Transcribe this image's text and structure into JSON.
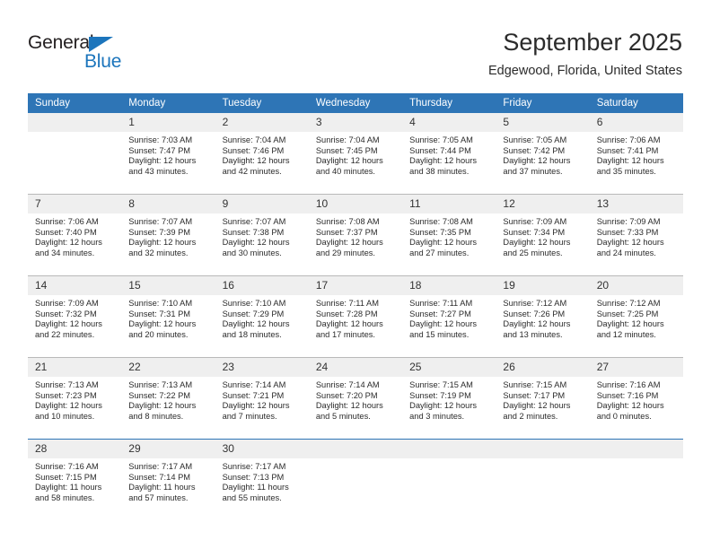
{
  "brand": {
    "name_dark": "General",
    "name_blue": "Blue",
    "accent_color": "#1c75bc"
  },
  "header": {
    "title": "September 2025",
    "subtitle": "Edgewood, Florida, United States"
  },
  "theme": {
    "header_row_bg": "#2e75b6",
    "header_row_text": "#ffffff",
    "daynumber_bg": "#efefef",
    "cell_border": "#b9b9b9",
    "text_color": "#2b2b2b"
  },
  "calendar": {
    "weekday_headers": [
      "Sunday",
      "Monday",
      "Tuesday",
      "Wednesday",
      "Thursday",
      "Friday",
      "Saturday"
    ],
    "weeks": [
      [
        {
          "day": ""
        },
        {
          "day": "1",
          "sunrise": "Sunrise: 7:03 AM",
          "sunset": "Sunset: 7:47 PM",
          "daylight_line1": "Daylight: 12 hours",
          "daylight_line2": "and 43 minutes."
        },
        {
          "day": "2",
          "sunrise": "Sunrise: 7:04 AM",
          "sunset": "Sunset: 7:46 PM",
          "daylight_line1": "Daylight: 12 hours",
          "daylight_line2": "and 42 minutes."
        },
        {
          "day": "3",
          "sunrise": "Sunrise: 7:04 AM",
          "sunset": "Sunset: 7:45 PM",
          "daylight_line1": "Daylight: 12 hours",
          "daylight_line2": "and 40 minutes."
        },
        {
          "day": "4",
          "sunrise": "Sunrise: 7:05 AM",
          "sunset": "Sunset: 7:44 PM",
          "daylight_line1": "Daylight: 12 hours",
          "daylight_line2": "and 38 minutes."
        },
        {
          "day": "5",
          "sunrise": "Sunrise: 7:05 AM",
          "sunset": "Sunset: 7:42 PM",
          "daylight_line1": "Daylight: 12 hours",
          "daylight_line2": "and 37 minutes."
        },
        {
          "day": "6",
          "sunrise": "Sunrise: 7:06 AM",
          "sunset": "Sunset: 7:41 PM",
          "daylight_line1": "Daylight: 12 hours",
          "daylight_line2": "and 35 minutes."
        }
      ],
      [
        {
          "day": "7",
          "sunrise": "Sunrise: 7:06 AM",
          "sunset": "Sunset: 7:40 PM",
          "daylight_line1": "Daylight: 12 hours",
          "daylight_line2": "and 34 minutes."
        },
        {
          "day": "8",
          "sunrise": "Sunrise: 7:07 AM",
          "sunset": "Sunset: 7:39 PM",
          "daylight_line1": "Daylight: 12 hours",
          "daylight_line2": "and 32 minutes."
        },
        {
          "day": "9",
          "sunrise": "Sunrise: 7:07 AM",
          "sunset": "Sunset: 7:38 PM",
          "daylight_line1": "Daylight: 12 hours",
          "daylight_line2": "and 30 minutes."
        },
        {
          "day": "10",
          "sunrise": "Sunrise: 7:08 AM",
          "sunset": "Sunset: 7:37 PM",
          "daylight_line1": "Daylight: 12 hours",
          "daylight_line2": "and 29 minutes."
        },
        {
          "day": "11",
          "sunrise": "Sunrise: 7:08 AM",
          "sunset": "Sunset: 7:35 PM",
          "daylight_line1": "Daylight: 12 hours",
          "daylight_line2": "and 27 minutes."
        },
        {
          "day": "12",
          "sunrise": "Sunrise: 7:09 AM",
          "sunset": "Sunset: 7:34 PM",
          "daylight_line1": "Daylight: 12 hours",
          "daylight_line2": "and 25 minutes."
        },
        {
          "day": "13",
          "sunrise": "Sunrise: 7:09 AM",
          "sunset": "Sunset: 7:33 PM",
          "daylight_line1": "Daylight: 12 hours",
          "daylight_line2": "and 24 minutes."
        }
      ],
      [
        {
          "day": "14",
          "sunrise": "Sunrise: 7:09 AM",
          "sunset": "Sunset: 7:32 PM",
          "daylight_line1": "Daylight: 12 hours",
          "daylight_line2": "and 22 minutes."
        },
        {
          "day": "15",
          "sunrise": "Sunrise: 7:10 AM",
          "sunset": "Sunset: 7:31 PM",
          "daylight_line1": "Daylight: 12 hours",
          "daylight_line2": "and 20 minutes."
        },
        {
          "day": "16",
          "sunrise": "Sunrise: 7:10 AM",
          "sunset": "Sunset: 7:29 PM",
          "daylight_line1": "Daylight: 12 hours",
          "daylight_line2": "and 18 minutes."
        },
        {
          "day": "17",
          "sunrise": "Sunrise: 7:11 AM",
          "sunset": "Sunset: 7:28 PM",
          "daylight_line1": "Daylight: 12 hours",
          "daylight_line2": "and 17 minutes."
        },
        {
          "day": "18",
          "sunrise": "Sunrise: 7:11 AM",
          "sunset": "Sunset: 7:27 PM",
          "daylight_line1": "Daylight: 12 hours",
          "daylight_line2": "and 15 minutes."
        },
        {
          "day": "19",
          "sunrise": "Sunrise: 7:12 AM",
          "sunset": "Sunset: 7:26 PM",
          "daylight_line1": "Daylight: 12 hours",
          "daylight_line2": "and 13 minutes."
        },
        {
          "day": "20",
          "sunrise": "Sunrise: 7:12 AM",
          "sunset": "Sunset: 7:25 PM",
          "daylight_line1": "Daylight: 12 hours",
          "daylight_line2": "and 12 minutes."
        }
      ],
      [
        {
          "day": "21",
          "sunrise": "Sunrise: 7:13 AM",
          "sunset": "Sunset: 7:23 PM",
          "daylight_line1": "Daylight: 12 hours",
          "daylight_line2": "and 10 minutes."
        },
        {
          "day": "22",
          "sunrise": "Sunrise: 7:13 AM",
          "sunset": "Sunset: 7:22 PM",
          "daylight_line1": "Daylight: 12 hours",
          "daylight_line2": "and 8 minutes."
        },
        {
          "day": "23",
          "sunrise": "Sunrise: 7:14 AM",
          "sunset": "Sunset: 7:21 PM",
          "daylight_line1": "Daylight: 12 hours",
          "daylight_line2": "and 7 minutes."
        },
        {
          "day": "24",
          "sunrise": "Sunrise: 7:14 AM",
          "sunset": "Sunset: 7:20 PM",
          "daylight_line1": "Daylight: 12 hours",
          "daylight_line2": "and 5 minutes."
        },
        {
          "day": "25",
          "sunrise": "Sunrise: 7:15 AM",
          "sunset": "Sunset: 7:19 PM",
          "daylight_line1": "Daylight: 12 hours",
          "daylight_line2": "and 3 minutes."
        },
        {
          "day": "26",
          "sunrise": "Sunrise: 7:15 AM",
          "sunset": "Sunset: 7:17 PM",
          "daylight_line1": "Daylight: 12 hours",
          "daylight_line2": "and 2 minutes."
        },
        {
          "day": "27",
          "sunrise": "Sunrise: 7:16 AM",
          "sunset": "Sunset: 7:16 PM",
          "daylight_line1": "Daylight: 12 hours",
          "daylight_line2": "and 0 minutes."
        }
      ],
      [
        {
          "day": "28",
          "sunrise": "Sunrise: 7:16 AM",
          "sunset": "Sunset: 7:15 PM",
          "daylight_line1": "Daylight: 11 hours",
          "daylight_line2": "and 58 minutes."
        },
        {
          "day": "29",
          "sunrise": "Sunrise: 7:17 AM",
          "sunset": "Sunset: 7:14 PM",
          "daylight_line1": "Daylight: 11 hours",
          "daylight_line2": "and 57 minutes."
        },
        {
          "day": "30",
          "sunrise": "Sunrise: 7:17 AM",
          "sunset": "Sunset: 7:13 PM",
          "daylight_line1": "Daylight: 11 hours",
          "daylight_line2": "and 55 minutes."
        },
        {
          "day": ""
        },
        {
          "day": ""
        },
        {
          "day": ""
        },
        {
          "day": ""
        }
      ]
    ]
  }
}
